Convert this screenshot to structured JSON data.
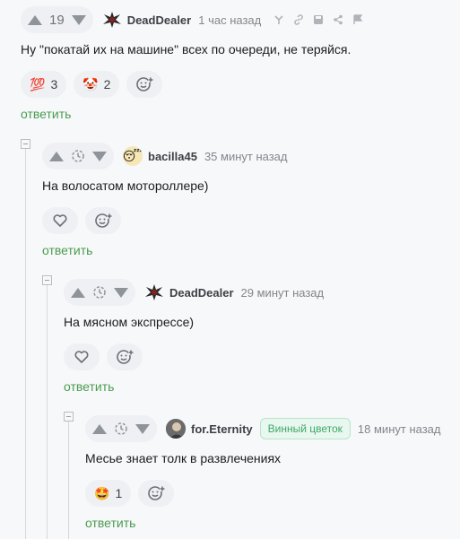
{
  "comments": [
    {
      "score": "19",
      "user": "DeadDealer",
      "time": "1 час назад",
      "text": "Ну \"покатай их на машине\" всех по очереди, не теряйся.",
      "reactions": [
        {
          "emoji": "💯",
          "count": "3"
        },
        {
          "emoji": "🤡",
          "count": "2"
        }
      ],
      "reply": "ответить"
    },
    {
      "user": "bacilla45",
      "time": "35 минут назад",
      "text": "На волосатом мотороллере)",
      "reply": "ответить"
    },
    {
      "user": "DeadDealer",
      "time": "29 минут назад",
      "text": "На мясном экспрессе)",
      "reply": "ответить"
    },
    {
      "user": "for.Eternity",
      "badge": "Винный цветок",
      "time": "18 минут назад",
      "text": "Месье знает толк в развлечениях",
      "reactions": [
        {
          "emoji": "🤩",
          "count": "1"
        }
      ],
      "reply": "ответить"
    }
  ],
  "icons": {
    "upvote": "triangle-up-icon",
    "downvote": "triangle-down-icon",
    "clock": "clock-icon",
    "heart": "heart-icon",
    "add_reaction": "smile-plus-icon",
    "link": "link-icon",
    "save": "save-icon",
    "share": "share-icon",
    "report": "flag-icon"
  }
}
